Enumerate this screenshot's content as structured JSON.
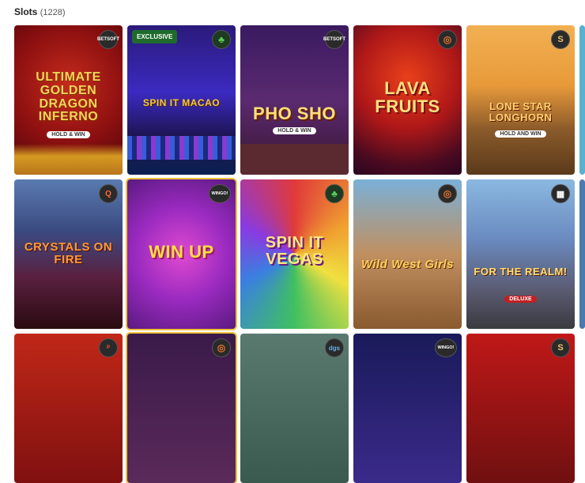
{
  "header": {
    "title": "Slots",
    "count": "(1228)"
  },
  "games": [
    {
      "id": "golden-dragon",
      "logo": "ULTIMATE GOLDEN DRAGON INFERNO",
      "sub": "HOLD & WIN",
      "provider": "BETSOFT",
      "exclusive": ""
    },
    {
      "id": "spin-it-macao",
      "logo": "SPIN IT MACAO",
      "sub": "",
      "provider": "clover",
      "exclusive": "EXCLUSIVE"
    },
    {
      "id": "pho-sho",
      "logo": "PHO SHO",
      "sub": "HOLD & WIN",
      "provider": "BETSOFT",
      "exclusive": ""
    },
    {
      "id": "lava-fruits",
      "logo": "LAVA FRUITS",
      "sub": "",
      "provider": "ring",
      "exclusive": ""
    },
    {
      "id": "lone-star-longhorn",
      "logo": "LONE STAR LONGHORN",
      "sub": "HOLD AND WIN",
      "provider": "S",
      "exclusive": ""
    },
    {
      "id": "crystals-on-fire",
      "logo": "CRYSTALS ON FIRE",
      "sub": "",
      "provider": "Q",
      "exclusive": ""
    },
    {
      "id": "win-up",
      "logo": "WIN UP",
      "sub": "",
      "provider": "WINGO!",
      "exclusive": ""
    },
    {
      "id": "spin-it-vegas",
      "logo": "SPIN IT VEGAS",
      "sub": "",
      "provider": "clover",
      "exclusive": ""
    },
    {
      "id": "wild-west-girls",
      "logo": "Wild West Girls",
      "sub": "",
      "provider": "ring",
      "exclusive": ""
    },
    {
      "id": "for-the-realm",
      "logo": "FOR THE REALM!",
      "sub": "DELUXE",
      "provider": "grid",
      "exclusive": ""
    },
    {
      "id": "row3-1",
      "logo": "",
      "sub": "",
      "provider": "P",
      "exclusive": ""
    },
    {
      "id": "row3-2",
      "logo": "",
      "sub": "",
      "provider": "ring",
      "exclusive": ""
    },
    {
      "id": "row3-3",
      "logo": "",
      "sub": "",
      "provider": "dgs",
      "exclusive": ""
    },
    {
      "id": "row3-4",
      "logo": "",
      "sub": "",
      "provider": "WINGO!",
      "exclusive": ""
    },
    {
      "id": "row3-5",
      "logo": "",
      "sub": "",
      "provider": "S",
      "exclusive": ""
    }
  ]
}
